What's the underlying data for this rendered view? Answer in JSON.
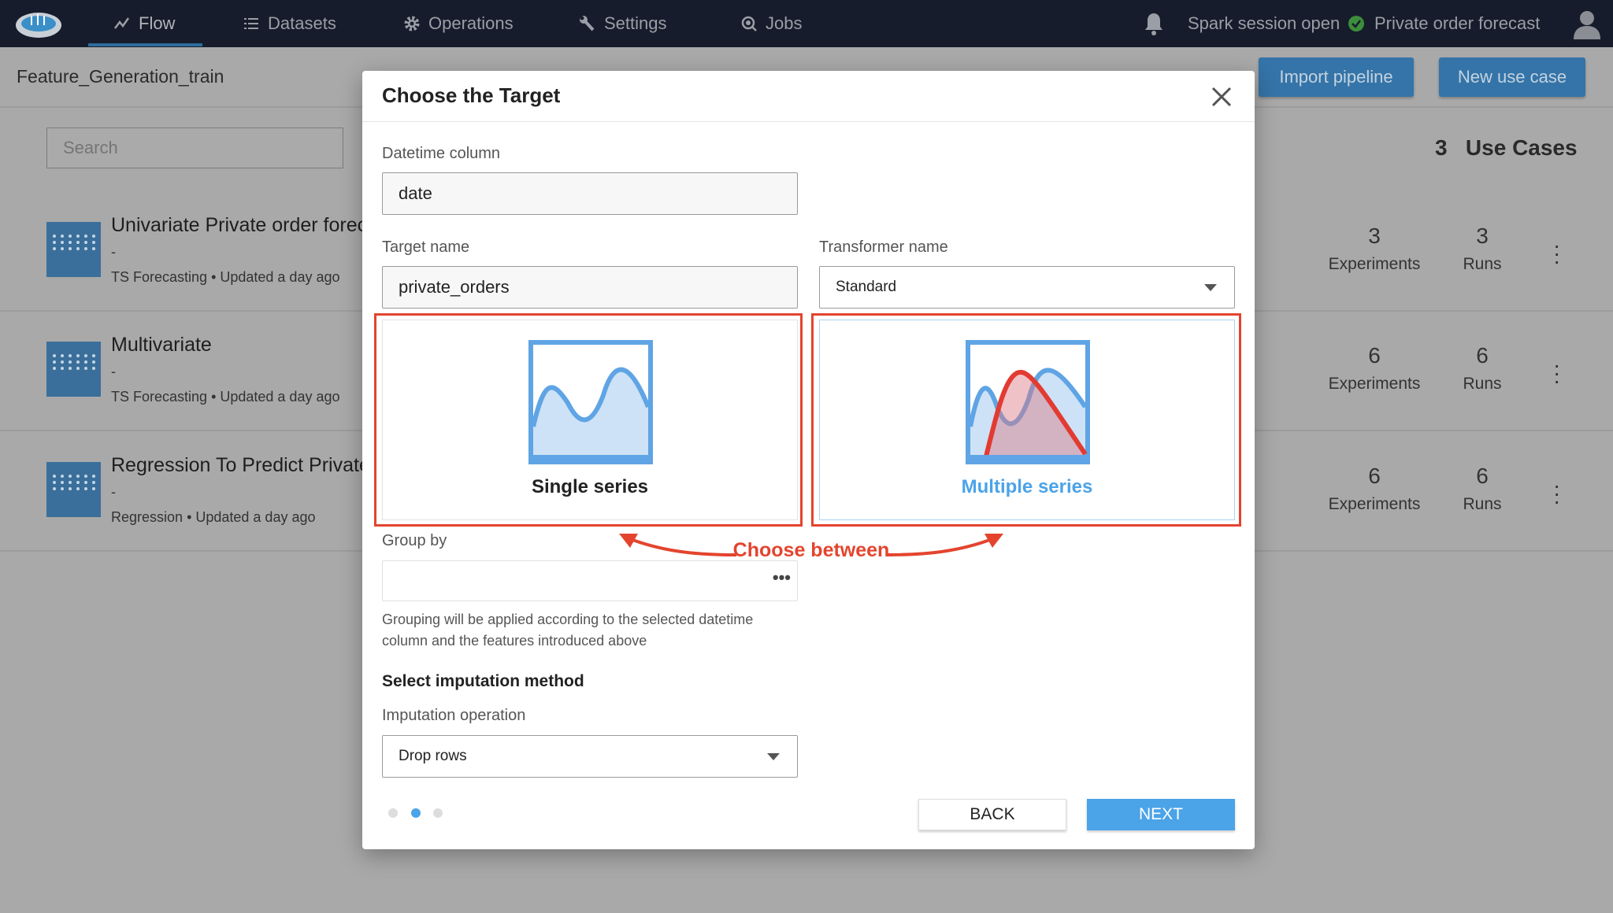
{
  "nav": {
    "items": [
      {
        "label": "Flow",
        "icon": "trend-icon"
      },
      {
        "label": "Datasets",
        "icon": "list-icon"
      },
      {
        "label": "Operations",
        "icon": "gear-icon"
      },
      {
        "label": "Settings",
        "icon": "wrench-icon"
      },
      {
        "label": "Jobs",
        "icon": "jobs-icon"
      }
    ],
    "active": "Flow",
    "session_status": "Spark session open",
    "project": "Private order forecast"
  },
  "page": {
    "title": "Feature_Generation_train",
    "import_label": "Import pipeline",
    "new_label": "New use case",
    "search_placeholder": "Search",
    "count": "3",
    "count_label": "Use Cases"
  },
  "use_cases": [
    {
      "title": "Univariate Private order forec",
      "desc": "-",
      "type": "TS Forecasting",
      "updated": "• Updated a day ago",
      "experiments": "3",
      "runs": "3"
    },
    {
      "title": "Multivariate",
      "desc": "-",
      "type": "TS Forecasting",
      "updated": "• Updated a day ago",
      "experiments": "6",
      "runs": "6"
    },
    {
      "title": "Regression To Predict Private",
      "desc": "-",
      "type": "Regression",
      "updated": "• Updated a day ago",
      "experiments": "6",
      "runs": "6"
    }
  ],
  "stat_labels": {
    "experiments": "Experiments",
    "runs": "Runs"
  },
  "modal": {
    "title": "Choose the Target",
    "datetime_label": "Datetime column",
    "datetime_value": "date",
    "target_label": "Target name",
    "target_value": "private_orders",
    "transformer_label": "Transformer name",
    "transformer_value": "Standard",
    "single_label": "Single series",
    "multiple_label": "Multiple series",
    "selected": "Multiple series",
    "groupby_label": "Group by",
    "groupby_value": "",
    "groupby_hint_1": "Grouping will be applied according to the selected datetime",
    "groupby_hint_2": "column and the features introduced above",
    "imputation_title": "Select imputation method",
    "imputation_label": "Imputation operation",
    "imputation_value": "Drop rows",
    "step": 2,
    "steps": 3,
    "back": "BACK",
    "next": "NEXT"
  },
  "annotation": {
    "text": "Choose between",
    "color": "#e4442e"
  },
  "colors": {
    "accent": "#4ba3e8",
    "nav_bg": "#161c2b",
    "success": "#3c8d3c"
  }
}
